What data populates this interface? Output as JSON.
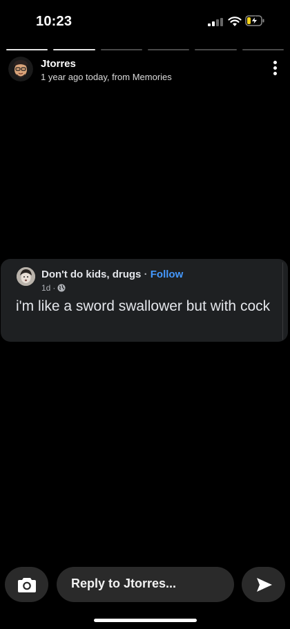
{
  "status": {
    "time": "10:23"
  },
  "story": {
    "segments_total": 6,
    "segments_viewed": 2
  },
  "header": {
    "username": "Jtorres",
    "subtitle": "1 year ago today, from Memories"
  },
  "post": {
    "author": "Don't do kids, drugs",
    "separator": " · ",
    "follow_label": "Follow",
    "meta_age": "1d",
    "meta_sep": " · ",
    "text": "i'm like a sword swallower but with cock"
  },
  "reply": {
    "placeholder": "Reply to Jtorres..."
  },
  "icons": {
    "camera": "camera-icon",
    "send": "send-icon",
    "more": "more-vertical-icon",
    "globe": "globe-icon"
  },
  "colors": {
    "background": "#000000",
    "card": "#1e2022",
    "follow": "#4599ff",
    "button": "#2a2a2a"
  }
}
